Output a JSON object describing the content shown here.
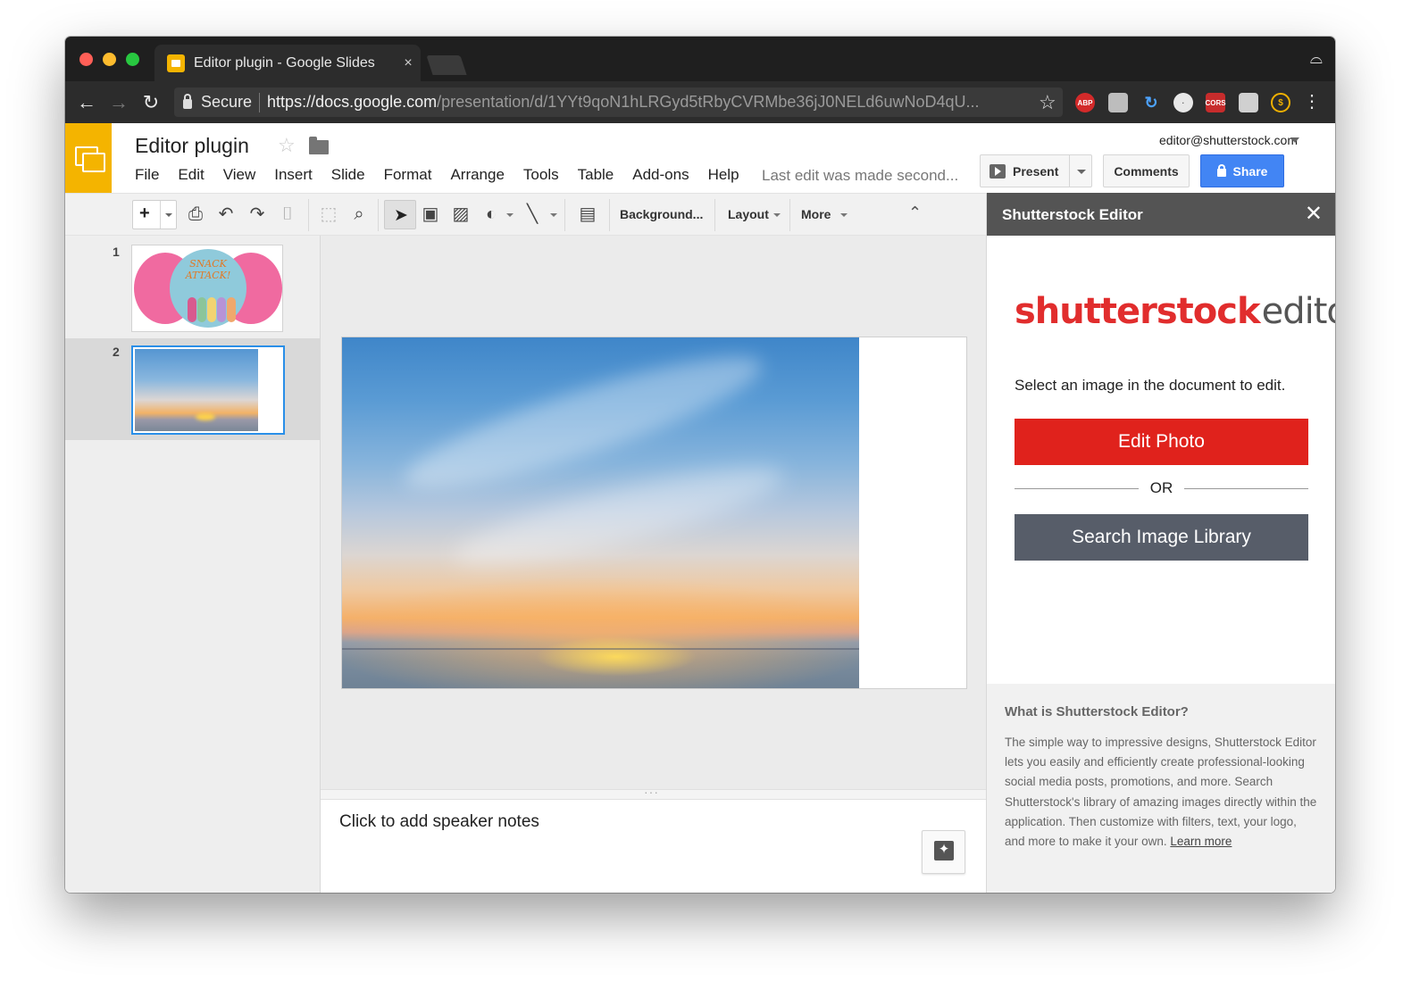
{
  "browser": {
    "tab_title": "Editor plugin - Google Slides",
    "tab_close": "×",
    "secure_label": "Secure",
    "url_host": "https://docs.google.com",
    "url_path": "/presentation/d/1YYt9qoN1hLRGyd5tRbyCVRMbe36jJ0NELd6uwNoD4qU...",
    "extensions": [
      "ABP",
      "CORS"
    ]
  },
  "docs": {
    "title": "Editor plugin",
    "menu": [
      "File",
      "Edit",
      "View",
      "Insert",
      "Slide",
      "Format",
      "Arrange",
      "Tools",
      "Table",
      "Add-ons",
      "Help"
    ],
    "last_edit": "Last edit was made second...",
    "account": "editor@shutterstock.com",
    "present_label": "Present",
    "comments_label": "Comments",
    "share_label": "Share"
  },
  "toolbar": {
    "background_label": "Background...",
    "layout_label": "Layout",
    "more_label": "More"
  },
  "filmstrip": {
    "slides": [
      {
        "number": "1",
        "text_line1": "SNACK",
        "text_line2": "ATTACK!"
      },
      {
        "number": "2"
      }
    ]
  },
  "notes": {
    "placeholder": "Click to add speaker notes"
  },
  "sidebar": {
    "title": "Shutterstock Editor",
    "close": "✕",
    "logo_brand": "shutterstock",
    "logo_product": "editor",
    "instruction": "Select an image in the document to edit.",
    "edit_button": "Edit Photo",
    "or_label": "OR",
    "search_button": "Search Image Library",
    "info_title": "What is Shutterstock Editor?",
    "info_body": "The simple way to impressive designs, Shutterstock Editor lets you easily and efficiently create professional-looking social media posts, promotions, and more. Search Shutterstock's library of amazing images directly within the application. Then customize with filters, text, your logo, and more to make it your own.",
    "learn_more": "Learn more"
  },
  "colors": {
    "slides_yellow": "#f4b400",
    "share_blue": "#4285f4",
    "edit_red": "#e0221c",
    "search_slate": "#575d69",
    "selection_blue": "#2a8fe8"
  }
}
